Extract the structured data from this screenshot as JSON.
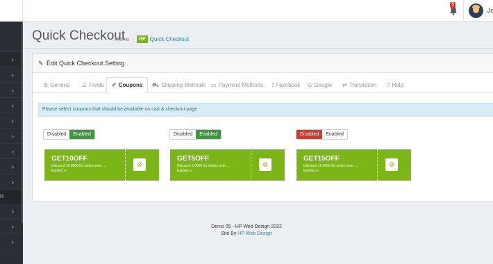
{
  "topbar": {
    "notification_count": "5",
    "user_name": "Jo",
    "icons": [
      "bell-icon",
      "avatar"
    ]
  },
  "sidebar": {
    "section_label": "n",
    "chevron": "›"
  },
  "header": {
    "title": "Quick Checkout",
    "breadcrumb_home": "Home",
    "breadcrumb_sep": "›",
    "breadcrumb_badge": "HP",
    "breadcrumb_current": "Quick Checkout"
  },
  "panel": {
    "heading_icon": "pencil-icon",
    "heading": "Edit Quick Checkout Setting",
    "tabs": [
      {
        "label": "General",
        "icon": "⚙"
      },
      {
        "label": "Fields",
        "icon": "☰"
      },
      {
        "label": "Coupons",
        "icon": "✐"
      },
      {
        "label": "Shipping Methods",
        "icon": "⛟"
      },
      {
        "label": "Payment Methods",
        "icon": "▭"
      },
      {
        "label": "Facebook",
        "icon": "f"
      },
      {
        "label": "Google",
        "icon": "G"
      },
      {
        "label": "Translation",
        "icon": "⇄"
      },
      {
        "label": "Help",
        "icon": "?"
      }
    ],
    "info": "Please select coupons that should be available on cart & checkout page",
    "toggle_labels": {
      "disabled": "Disabled",
      "enabled": "Enabled"
    },
    "coupons": [
      {
        "code": "GET10OFF",
        "description": "Discount 10.0000 for orders over ...",
        "expires": "Expires ∞",
        "state": "Enabled"
      },
      {
        "code": "GET5OFF",
        "description": "Discount 5.0000 for orders over ...",
        "expires": "Expires ∞",
        "state": "Enabled"
      },
      {
        "code": "GET15OFF",
        "description": "Discount 15.0000 for orders over ...",
        "expires": "Expires ∞",
        "state": "Disabled"
      }
    ]
  },
  "footer": {
    "line1": "Demo 05 - HP Web Design 2022",
    "line2_prefix": "Site By",
    "line2_link": "HP Web Design"
  },
  "colors": {
    "accent_green": "#7cb518",
    "enabled_green": "#3b9a3b",
    "disabled_red": "#d43a2a",
    "link_blue": "#1e88c7",
    "sidebar_bg": "#2b2f35"
  }
}
